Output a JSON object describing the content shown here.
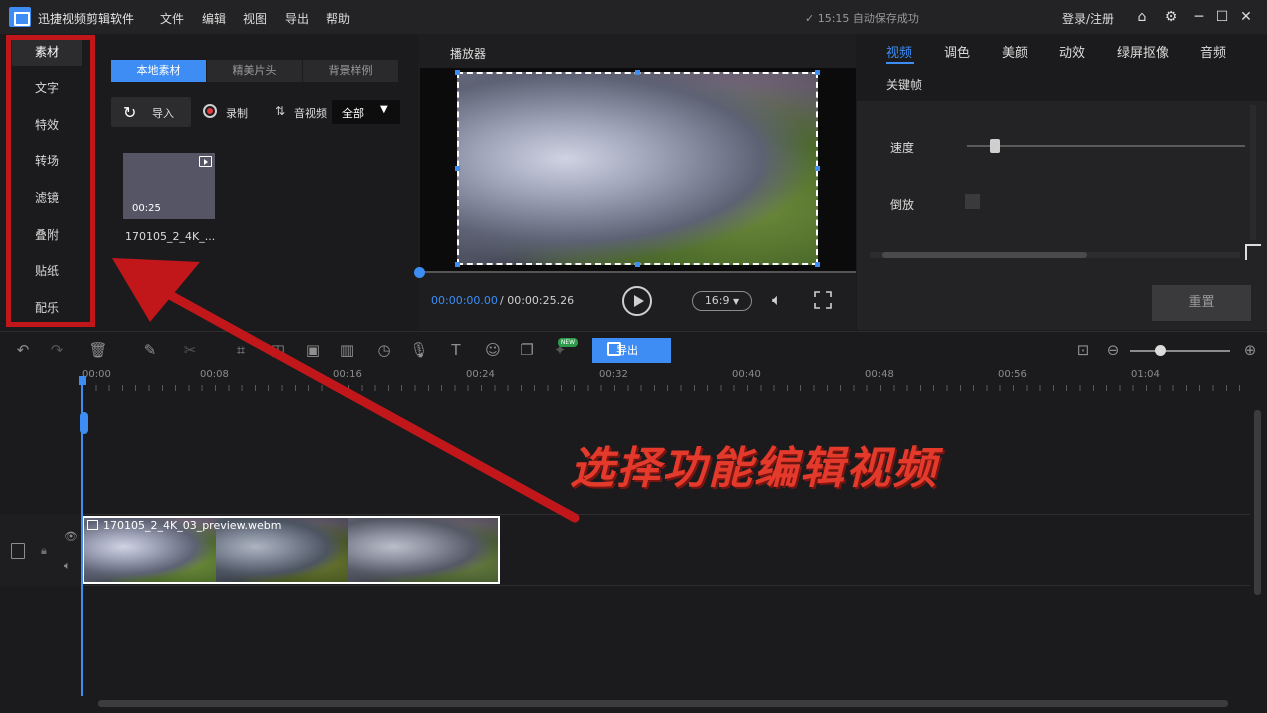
{
  "titlebar": {
    "app_title": "迅捷视频剪辑软件",
    "menus": [
      "文件",
      "编辑",
      "视图",
      "导出",
      "帮助"
    ],
    "autosave_text": "15:15 自动保存成功",
    "login": "登录/注册"
  },
  "leftnav": {
    "items": [
      "素材",
      "文字",
      "特效",
      "转场",
      "滤镜",
      "叠附",
      "贴纸",
      "配乐"
    ],
    "active_index": 0
  },
  "material": {
    "tabs": [
      "本地素材",
      "精美片头",
      "背景样例"
    ],
    "import_label": "导入",
    "record_label": "录制",
    "av_label": "音视频",
    "filter_value": "全部",
    "thumb_duration": "00:25",
    "thumb_name": "170105_2_4K_..."
  },
  "player": {
    "title": "播放器",
    "time_current": "00:00:00.00",
    "time_total": "/ 00:00:25.26",
    "ratio": "16:9",
    "progress": 0
  },
  "props": {
    "tabs": [
      "视频",
      "调色",
      "美颜",
      "动效",
      "绿屏抠像",
      "音频"
    ],
    "keyframe_tab": "关键帧",
    "speed_label": "速度",
    "reverse_label": "倒放",
    "reset_label": "重置"
  },
  "timeline": {
    "export_label": "导出",
    "new_badge": "NEW",
    "ticks": [
      "00:00",
      "00:08",
      "00:16",
      "00:24",
      "00:32",
      "00:40",
      "00:48",
      "00:56",
      "01:04"
    ],
    "clip_name": "170105_2_4K_03_preview.webm"
  },
  "annotation": {
    "text": "选择功能编辑视频"
  },
  "colors": {
    "accent": "#3d8df5",
    "annotation_red": "#c2171a"
  }
}
